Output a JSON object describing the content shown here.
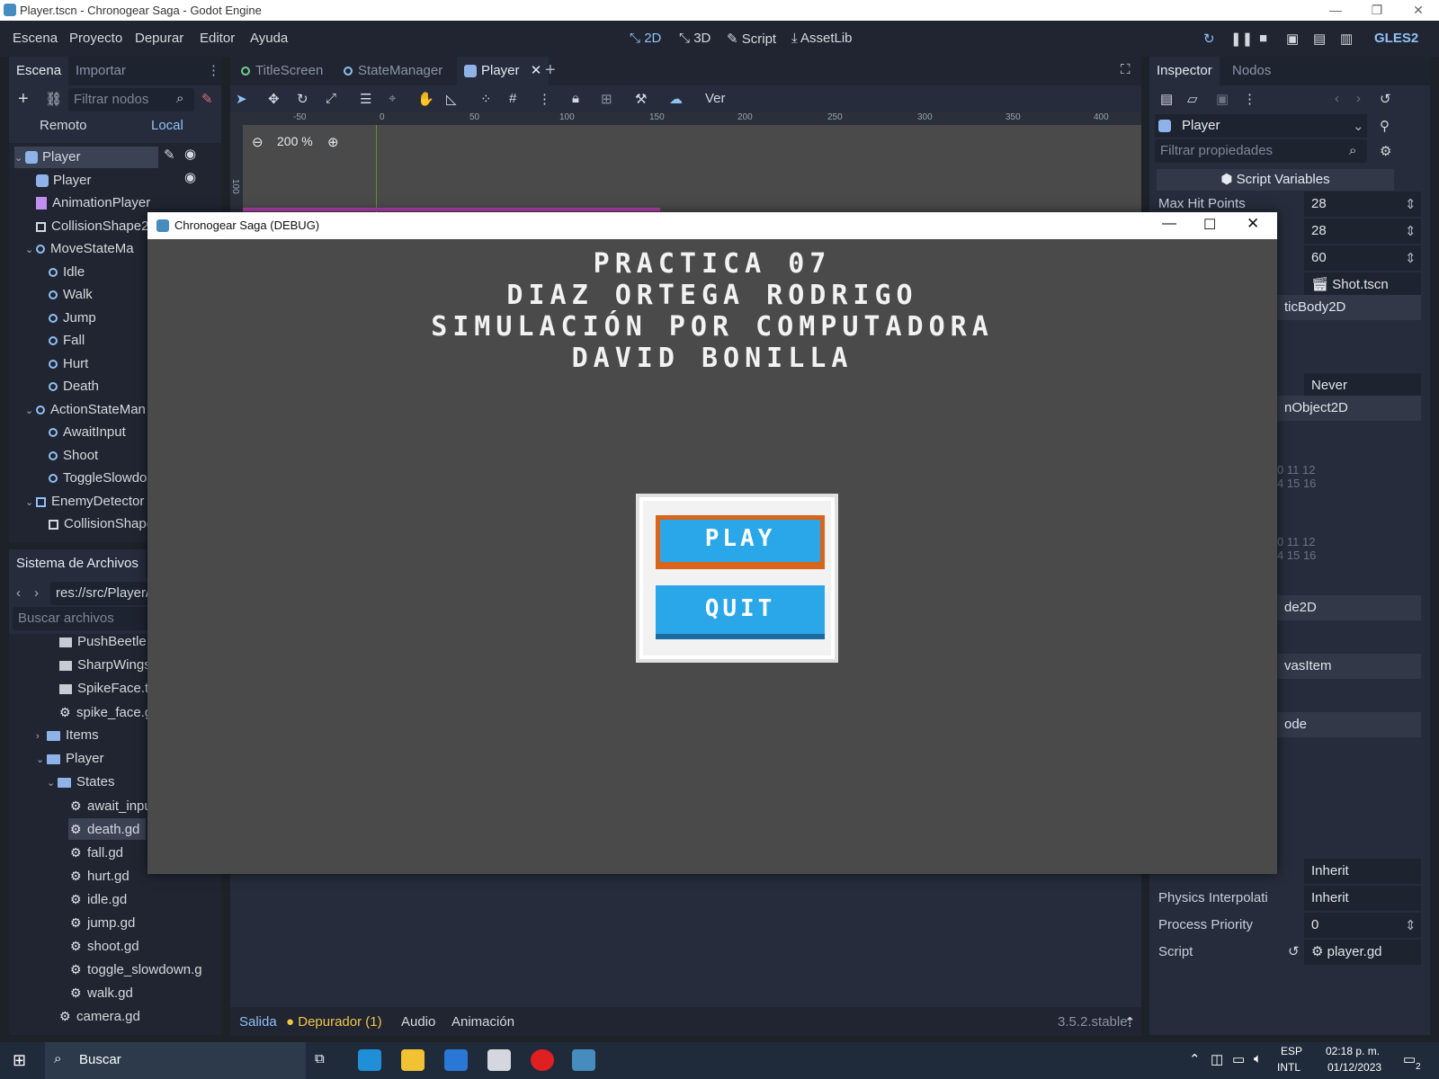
{
  "window": {
    "title": "Player.tscn - Chronogear Saga - Godot Engine"
  },
  "menu": {
    "items": [
      "Escena",
      "Proyecto",
      "Depurar",
      "Editor",
      "Ayuda"
    ]
  },
  "workspaces": {
    "w2d": "2D",
    "w3d": "3D",
    "script": "Script",
    "assetlib": "AssetLib",
    "renderer": "GLES2"
  },
  "scene_dock": {
    "tab_scene": "Escena",
    "tab_import": "Importar",
    "filter_placeholder": "Filtrar nodos",
    "remote": "Remoto",
    "local": "Local",
    "nodes": [
      {
        "label": "Player",
        "icon": "player-icon"
      },
      {
        "label": "Player",
        "icon": "sprite-icon"
      },
      {
        "label": "AnimationPlayer",
        "icon": "animation-icon"
      },
      {
        "label": "CollisionShape2",
        "icon": "collision-icon"
      },
      {
        "label": "MoveStateMa",
        "icon": "state-icon"
      },
      {
        "label": "Idle",
        "icon": "state-icon"
      },
      {
        "label": "Walk",
        "icon": "state-icon"
      },
      {
        "label": "Jump",
        "icon": "state-icon"
      },
      {
        "label": "Fall",
        "icon": "state-icon"
      },
      {
        "label": "Hurt",
        "icon": "state-icon"
      },
      {
        "label": "Death",
        "icon": "state-icon"
      },
      {
        "label": "ActionStateMan",
        "icon": "state-icon"
      },
      {
        "label": "AwaitInput",
        "icon": "state-icon"
      },
      {
        "label": "Shoot",
        "icon": "state-icon"
      },
      {
        "label": "ToggleSlowdo",
        "icon": "state-icon"
      },
      {
        "label": "EnemyDetector",
        "icon": "area-icon"
      },
      {
        "label": "CollisionShape",
        "icon": "collision-icon"
      }
    ]
  },
  "filesystem": {
    "title": "Sistema de Archivos",
    "path": "res://src/Player/",
    "search_placeholder": "Buscar archivos",
    "items": [
      {
        "label": "PushBeetle.t",
        "icon": "scene-icon"
      },
      {
        "label": "SharpWings",
        "icon": "scene-icon"
      },
      {
        "label": "SpikeFace.ts",
        "icon": "scene-icon"
      },
      {
        "label": "spike_face.g",
        "icon": "gear-icon"
      },
      {
        "label": "Items",
        "icon": "folder-icon"
      },
      {
        "label": "Player",
        "icon": "folder-icon"
      },
      {
        "label": "States",
        "icon": "folder-icon"
      },
      {
        "label": "await_inpu",
        "icon": "gear-icon"
      },
      {
        "label": "death.gd",
        "icon": "gear-icon"
      },
      {
        "label": "fall.gd",
        "icon": "gear-icon"
      },
      {
        "label": "hurt.gd",
        "icon": "gear-icon"
      },
      {
        "label": "idle.gd",
        "icon": "gear-icon"
      },
      {
        "label": "jump.gd",
        "icon": "gear-icon"
      },
      {
        "label": "shoot.gd",
        "icon": "gear-icon"
      },
      {
        "label": "toggle_slowdown.g",
        "icon": "gear-icon"
      },
      {
        "label": "walk.gd",
        "icon": "gear-icon"
      },
      {
        "label": "camera.gd",
        "icon": "gear-icon"
      }
    ]
  },
  "editor_tabs": [
    "TitleScreen",
    "StateManager",
    "Player"
  ],
  "viewport": {
    "zoom": "200 %",
    "view_menu": "Ver",
    "ruler_ticks": [
      "-50",
      "0",
      "50",
      "100",
      "150",
      "200",
      "250",
      "300",
      "350",
      "400"
    ],
    "vruler_tick": "100"
  },
  "game": {
    "window_title": "Chronogear Saga (DEBUG)",
    "lines": [
      "PRACTICA 07",
      "DIAZ ORTEGA RODRIGO",
      "SIMULACIÓN POR COMPUTADORA",
      "DAVID BONILLA"
    ],
    "play": "PLAY",
    "quit": "QUIT"
  },
  "inspector": {
    "tab_inspector": "Inspector",
    "tab_nodes": "Nodos",
    "node": "Player",
    "filter_placeholder": "Filtrar propiedades",
    "section": "Script Variables",
    "max_hit_points_label": "Max Hit Points",
    "max_hit_points": "28",
    "val2": "28",
    "val3": "60",
    "shot_scene": "Shot.tscn",
    "class1": "ticBody2D",
    "never": "Never",
    "class2": "nObject2D",
    "layers_row1": [
      "0",
      "11",
      "12"
    ],
    "layers_row2": [
      "4",
      "15",
      "16"
    ],
    "class3": "de2D",
    "class4": "vasItem",
    "class5": "ode",
    "inherit1": "Inherit",
    "physics_interp_label": "Physics Interpolati",
    "physics_interp": "Inherit",
    "process_priority_label": "Process Priority",
    "process_priority": "0",
    "script_label": "Script",
    "script": "player.gd"
  },
  "bottom": {
    "tabs": [
      "Salida",
      "Depurador (1)",
      "Audio",
      "Animación"
    ],
    "version": "3.5.2.stable"
  },
  "taskbar": {
    "search": "Buscar",
    "lang": "ESP",
    "layout": "INTL",
    "time": "02:18 p. m.",
    "date": "01/12/2023",
    "notif": "2"
  }
}
